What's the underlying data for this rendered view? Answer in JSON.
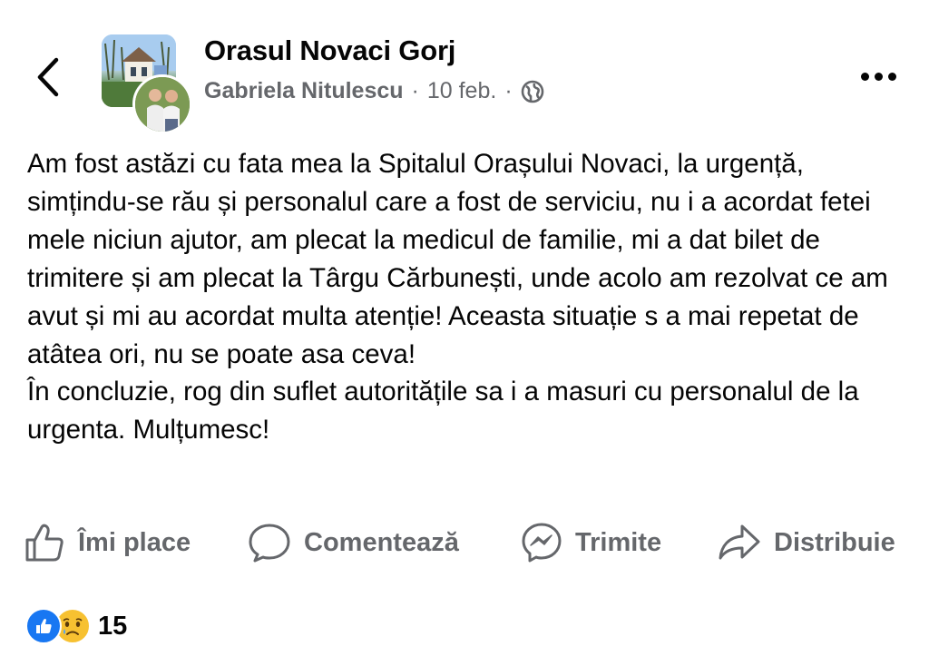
{
  "header": {
    "page_name": "Orasul Novaci Gorj",
    "author": "Gabriela Nitulescu",
    "date": "10 feb.",
    "separator": "·",
    "icons": {
      "back": "chevron-left-icon",
      "privacy": "globe-icon",
      "more": "more-horizontal-icon"
    }
  },
  "post": {
    "paragraphs": [
      "Am fost astăzi cu fata mea la Spitalul Orașului Novaci, la urgență, simțindu-se rău și personalul care a fost de serviciu, nu i a acordat fetei mele niciun ajutor, am plecat la medicul de familie, mi a dat bilet de trimitere și am plecat la Târgu Cărbunești, unde acolo am rezolvat ce am avut și mi au acordat multa atenție! Aceasta situație s a mai repetat de atâtea ori, nu se poate asa ceva!",
      "În concluzie, rog din suflet autoritățile sa i a  masuri cu personalul de la urgenta. Mulțumesc!"
    ]
  },
  "actions": {
    "like": "Îmi place",
    "comment": "Comentează",
    "send": "Trimite",
    "share": "Distribuie"
  },
  "reactions": {
    "types": [
      "like",
      "sad"
    ],
    "count": "15"
  },
  "colors": {
    "text": "#050505",
    "secondary": "#65676b",
    "like_blue": "#1877f2",
    "sad_yellow": "#f7c131"
  }
}
